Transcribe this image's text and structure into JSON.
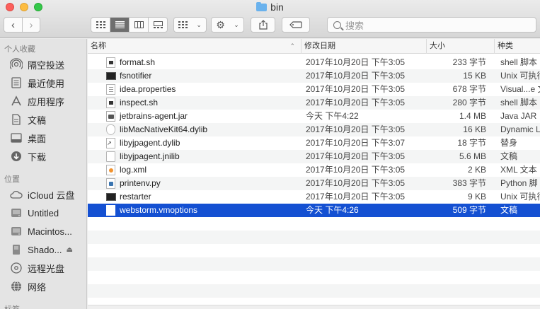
{
  "window": {
    "title": "bin"
  },
  "toolbar": {
    "search_placeholder": "搜索"
  },
  "sidebar": {
    "favorites_header": "个人收藏",
    "favorites": [
      {
        "label": "隔空投送",
        "icon": "airdrop-icon"
      },
      {
        "label": "最近使用",
        "icon": "recents-icon"
      },
      {
        "label": "应用程序",
        "icon": "applications-icon"
      },
      {
        "label": "文稿",
        "icon": "documents-icon"
      },
      {
        "label": "桌面",
        "icon": "desktop-icon"
      },
      {
        "label": "下载",
        "icon": "downloads-icon"
      }
    ],
    "locations_header": "位置",
    "locations": [
      {
        "label": "iCloud 云盘",
        "icon": "icloud-icon"
      },
      {
        "label": "Untitled",
        "icon": "disk-icon"
      },
      {
        "label": "Macintos...",
        "icon": "disk-icon"
      },
      {
        "label": "Shado...",
        "icon": "disk-icon"
      },
      {
        "label": "远程光盘",
        "icon": "remote-disc-icon"
      },
      {
        "label": "网络",
        "icon": "network-icon"
      }
    ],
    "tags_header": "标签"
  },
  "columns": {
    "name": "名称",
    "date": "修改日期",
    "size": "大小",
    "kind": "种类"
  },
  "files": [
    {
      "name": "format.sh",
      "date": "2017年10月20日 下午3:05",
      "size": "233 字节",
      "kind": "shell 脚本",
      "icon": "script-icon"
    },
    {
      "name": "fsnotifier",
      "date": "2017年10月20日 下午3:05",
      "size": "15 KB",
      "kind": "Unix 可执行",
      "icon": "terminal-icon"
    },
    {
      "name": "idea.properties",
      "date": "2017年10月20日 下午3:05",
      "size": "678 字节",
      "kind": "Visual...e 文稿",
      "icon": "text-document-icon"
    },
    {
      "name": "inspect.sh",
      "date": "2017年10月20日 下午3:05",
      "size": "280 字节",
      "kind": "shell 脚本",
      "icon": "script-icon"
    },
    {
      "name": "jetbrains-agent.jar",
      "date": "今天 下午4:22",
      "size": "1.4 MB",
      "kind": "Java JAR",
      "icon": "jar-icon"
    },
    {
      "name": "libMacNativeKit64.dylib",
      "date": "2017年10月20日 下午3:05",
      "size": "16 KB",
      "kind": "Dynamic Li",
      "icon": "dylib-icon"
    },
    {
      "name": "libyjpagent.dylib",
      "date": "2017年10月20日 下午3:07",
      "size": "18 字节",
      "kind": "替身",
      "icon": "alias-icon"
    },
    {
      "name": "libyjpagent.jnilib",
      "date": "2017年10月20日 下午3:05",
      "size": "5.6 MB",
      "kind": "文稿",
      "icon": "document-icon"
    },
    {
      "name": "log.xml",
      "date": "2017年10月20日 下午3:05",
      "size": "2 KB",
      "kind": "XML 文本",
      "icon": "xml-icon"
    },
    {
      "name": "printenv.py",
      "date": "2017年10月20日 下午3:05",
      "size": "383 字节",
      "kind": "Python 脚",
      "icon": "python-icon"
    },
    {
      "name": "restarter",
      "date": "2017年10月20日 下午3:05",
      "size": "9 KB",
      "kind": "Unix 可执行",
      "icon": "terminal-icon"
    },
    {
      "name": "webstorm.vmoptions",
      "date": "今天 下午4:26",
      "size": "509 字节",
      "kind": "文稿",
      "icon": "document-icon",
      "selected": true
    }
  ],
  "colors": {
    "selection": "#1450d2",
    "close": "#fc605c",
    "minimize": "#fdbc40",
    "maximize": "#34c84a"
  }
}
